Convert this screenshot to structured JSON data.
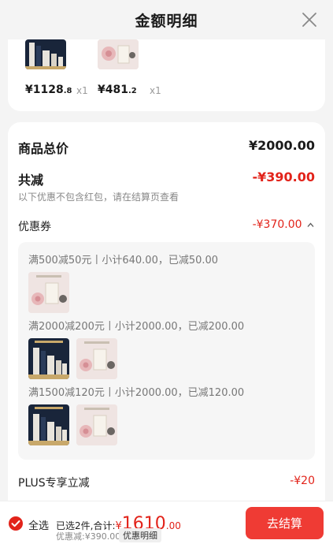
{
  "header": {
    "title": "金额明细"
  },
  "items": [
    {
      "price_int": "¥1128",
      "price_dec": ".8",
      "qty": "x1"
    },
    {
      "price_int": "¥481",
      "price_dec": ".2",
      "qty": "x1"
    }
  ],
  "summary": {
    "total_label": "商品总价",
    "total_value": "¥2000.00",
    "reduce_label": "共减",
    "reduce_value": "-¥390.00",
    "note": "以下优惠不包含红包，请在结算页查看",
    "coupon_label": "优惠券",
    "coupon_value": "-¥370.00",
    "coupon_rules": [
      "满500减50元丨小计640.00，已减50.00",
      "满2000减200元丨小计2000.00，已减200.00",
      "满1500减120元丨小计2000.00，已减120.00"
    ],
    "plus_label": "PLUS专享立减",
    "plus_value": "-¥20"
  },
  "bottom": {
    "select_all": "全选",
    "selected_text": "已选2件,合计:",
    "total_currency": "¥",
    "total_int": "1610",
    "total_dec": ".00",
    "discount_text": "优惠减:¥390.00",
    "detail_tag": "优惠明细",
    "checkout": "去结算"
  },
  "colors": {
    "accent": "#e2231a",
    "button": "#ef3b34"
  }
}
